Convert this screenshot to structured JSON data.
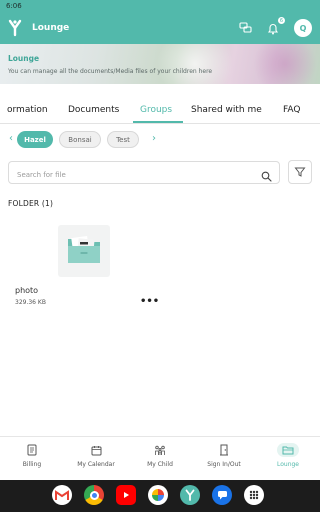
{
  "status_bar": {
    "time": "6:06"
  },
  "app_bar": {
    "title": "Lounge",
    "notification_count": "6",
    "avatar_initial": "Q"
  },
  "banner": {
    "title": "Lounge",
    "subtitle": "You can manage all the documents/Media files of your children here"
  },
  "tabs": [
    {
      "label": "ormation",
      "active": false
    },
    {
      "label": "Documents",
      "active": false
    },
    {
      "label": "Groups",
      "active": true
    },
    {
      "label": "Shared with me",
      "active": false
    },
    {
      "label": "FAQ",
      "active": false
    }
  ],
  "chips": [
    {
      "label": "Hazel",
      "active": true
    },
    {
      "label": "Bonsai",
      "active": false
    },
    {
      "label": "Test",
      "active": false
    }
  ],
  "search": {
    "placeholder": "Search for file",
    "value": ""
  },
  "folder_section": {
    "heading": "FOLDER (1)",
    "items": [
      {
        "name": "photo",
        "size": "329.36 KB",
        "more_label": "•••"
      }
    ]
  },
  "bottom_nav": [
    {
      "label": "Billing",
      "icon": "billing-icon",
      "active": false
    },
    {
      "label": "My Calendar",
      "icon": "calendar-icon",
      "active": false
    },
    {
      "label": "My Child",
      "icon": "child-icon",
      "active": false
    },
    {
      "label": "Sign In/Out",
      "icon": "door-icon",
      "active": false
    },
    {
      "label": "Lounge",
      "icon": "lounge-icon",
      "active": true
    }
  ],
  "dock_apps": [
    "gmail-icon",
    "chrome-icon",
    "youtube-icon",
    "photos-icon",
    "app-logo-icon",
    "messages-icon",
    "app-drawer-icon"
  ],
  "colors": {
    "accent": "#52b9ab",
    "accent_light": "#e4f4f1",
    "text": "#222222"
  }
}
